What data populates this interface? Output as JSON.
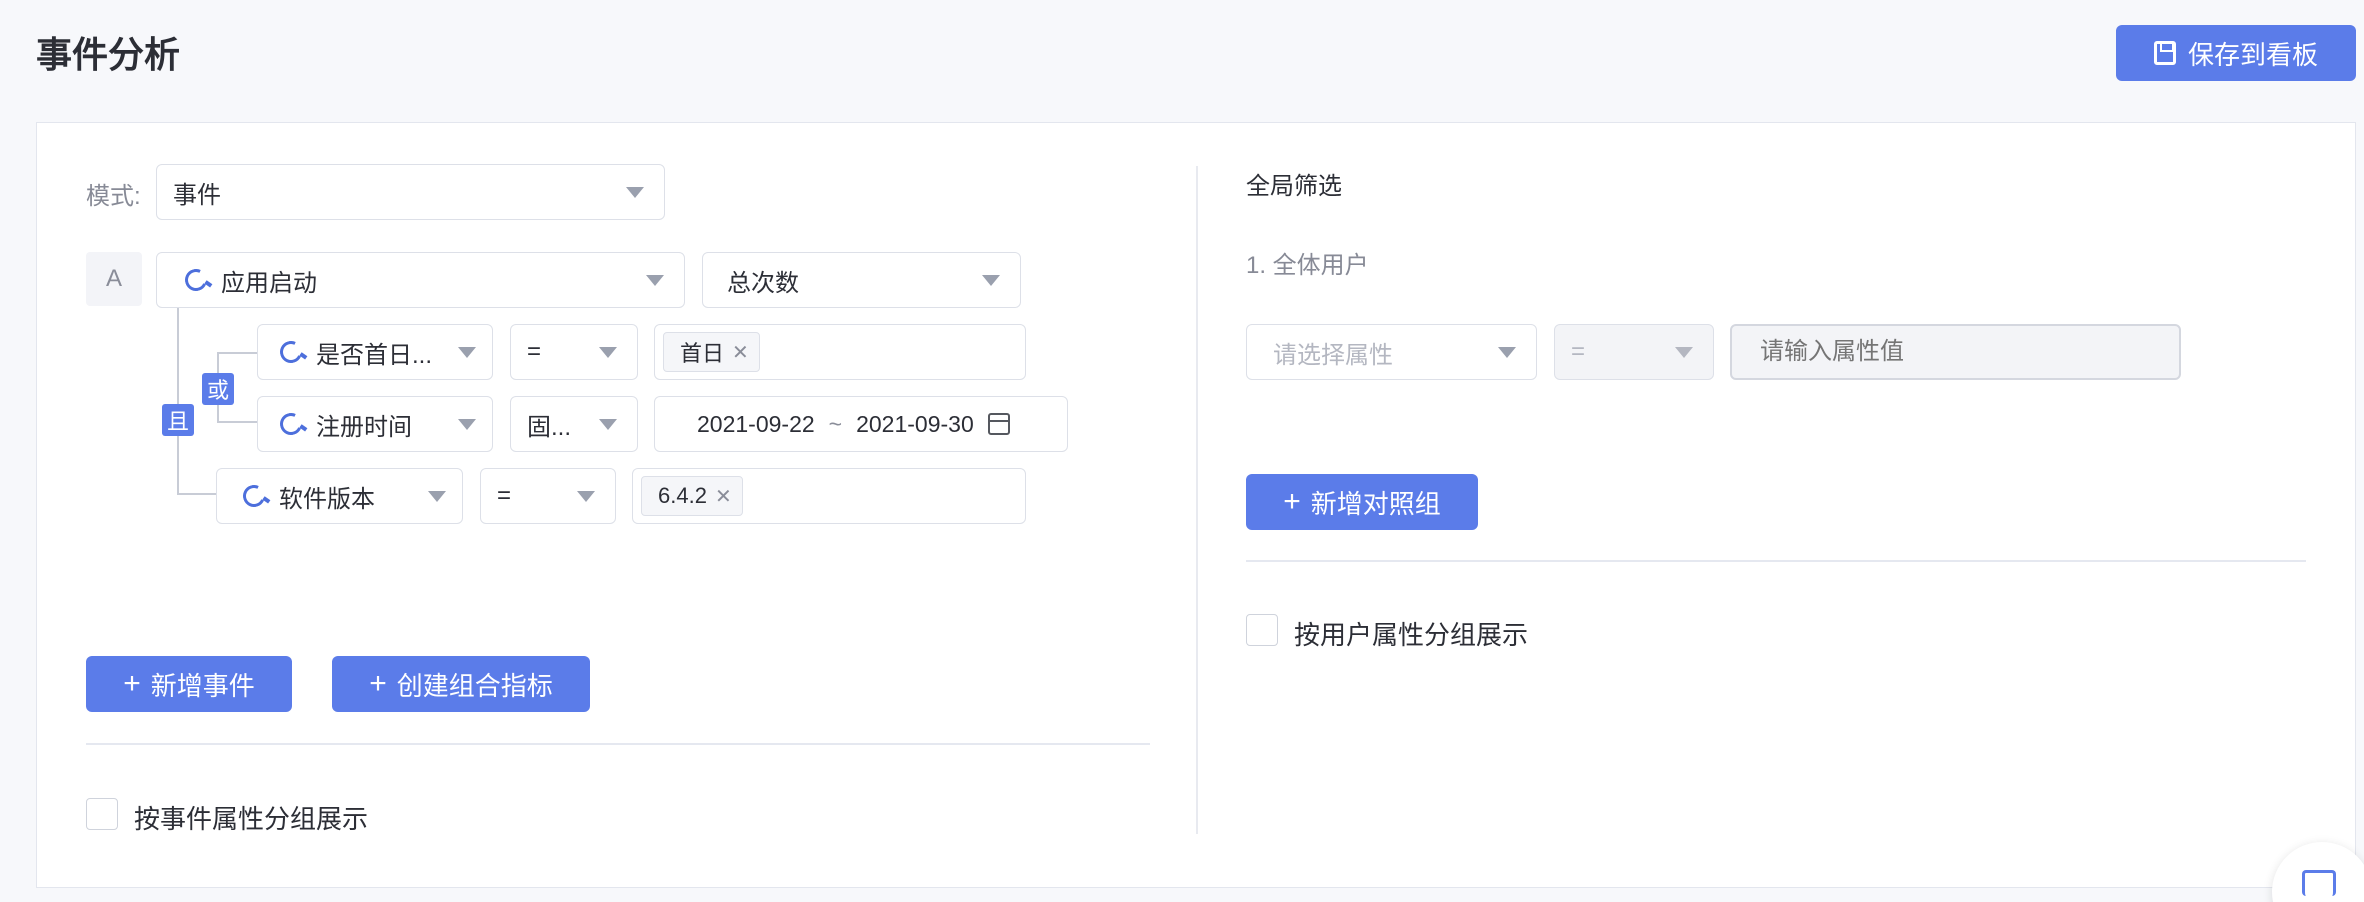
{
  "header": {
    "title": "事件分析",
    "save_button": "保存到看板"
  },
  "left": {
    "mode_label": "模式:",
    "mode_value": "事件",
    "event_badge": "A",
    "event_name": "应用启动",
    "metric": "总次数",
    "logic_or": "或",
    "logic_and": "且",
    "filters": [
      {
        "property": "是否首日...",
        "operator": "=",
        "value": "首日"
      },
      {
        "property": "注册时间",
        "operator": "固...",
        "date_start": "2021-09-22",
        "date_sep": "~",
        "date_end": "2021-09-30"
      },
      {
        "property": "软件版本",
        "operator": "=",
        "value": "6.4.2"
      }
    ],
    "add_event_button": "新增事件",
    "create_metric_button": "创建组合指标",
    "group_by_label": "按事件属性分组展示"
  },
  "right": {
    "title": "全局筛选",
    "group_item": "1. 全体用户",
    "property_placeholder": "请选择属性",
    "operator": "=",
    "value_placeholder": "请输入属性值",
    "add_group_button": "新增对照组",
    "group_by_label": "按用户属性分组展示"
  },
  "colors": {
    "primary": "#5b7ce9",
    "text": "#2c2e36"
  }
}
